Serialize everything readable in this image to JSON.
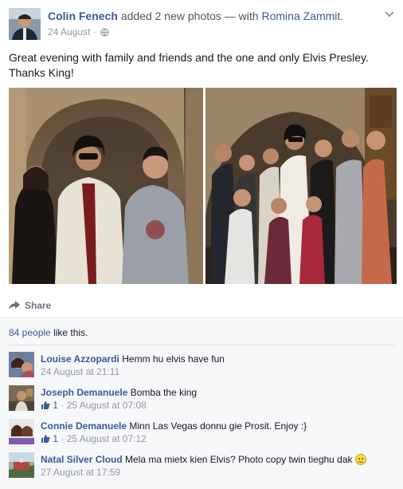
{
  "post": {
    "author": "Colin Fenech",
    "action": "added 2 new photos",
    "with_prefix": "— with",
    "tagged": "Romina Zammit",
    "end": ".",
    "date": "24 August",
    "date_sep": "·",
    "text": "Great evening with family and friends and the one and only Elvis Presley. Thanks King!",
    "share_label": "Share"
  },
  "likes": {
    "count_link": "84 people",
    "suffix": "like this."
  },
  "comments": [
    {
      "name": "Louise Azzopardi",
      "text": "Hemm hu elvis have fun",
      "likes": "",
      "time": "24 August at 21:11"
    },
    {
      "name": "Joseph Demanuele",
      "text": "Bomba the king",
      "likes": "1",
      "time": "25 August at 07:08"
    },
    {
      "name": "Connie Demanuele",
      "text": "Minn Las Vegas donnu gie Prosit. Enjoy :}",
      "likes": "1",
      "time": "25 August at 07:12"
    },
    {
      "name": "Natal Silver Cloud",
      "text": "Mela ma mietx kien Elvis? Photo copy twin tieghu dak",
      "likes": "",
      "time": "27 August at 17:59"
    }
  ],
  "meta_sep": "·",
  "icons": {
    "privacy": "globe-icon",
    "menu": "chevron-down-icon",
    "share": "share-arrow-icon",
    "comment_like": "thumbs-up-icon",
    "emoji": "smiley-icon"
  },
  "colors": {
    "link": "#3b5998",
    "meta": "#9197a3",
    "ufi_background": "#f6f7f9"
  }
}
